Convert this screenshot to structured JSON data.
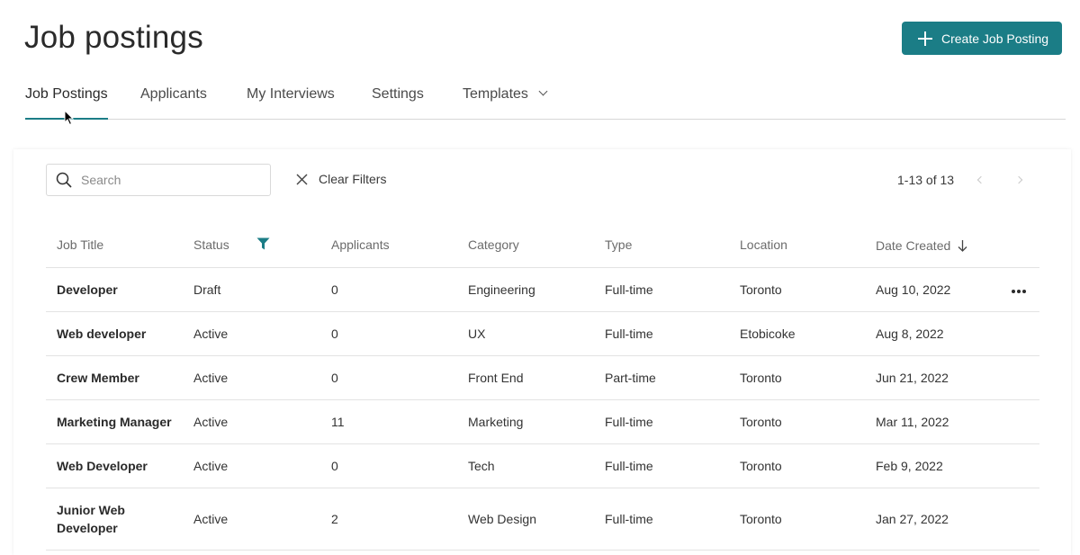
{
  "page_title": "Job postings",
  "create_button": {
    "label": "Create Job Posting"
  },
  "tabs": [
    {
      "label": "Job Postings",
      "active": true
    },
    {
      "label": "Applicants"
    },
    {
      "label": "My Interviews"
    },
    {
      "label": "Settings"
    },
    {
      "label": "Templates",
      "has_dropdown": true
    }
  ],
  "search": {
    "placeholder": "Search",
    "value": ""
  },
  "clear_filters": {
    "label": "Clear Filters"
  },
  "pagination": {
    "label": "1-13 of 13"
  },
  "columns": [
    "Job Title",
    "Status",
    "Applicants",
    "Category",
    "Type",
    "Location",
    "Date Created"
  ],
  "rows": [
    {
      "title": "Developer",
      "status": "Draft",
      "applicants": "0",
      "category": "Engineering",
      "type": "Full-time",
      "location": "Toronto",
      "date": "Aug 10, 2022"
    },
    {
      "title": "Web developer",
      "status": "Active",
      "applicants": "0",
      "category": "UX",
      "type": "Full-time",
      "location": "Etobicoke",
      "date": "Aug 8, 2022"
    },
    {
      "title": "Crew Member",
      "status": "Active",
      "applicants": "0",
      "category": "Front End",
      "type": "Part-time",
      "location": "Toronto",
      "date": "Jun 21, 2022"
    },
    {
      "title": "Marketing Manager",
      "status": "Active",
      "applicants": "11",
      "category": "Marketing",
      "type": "Full-time",
      "location": "Toronto",
      "date": "Mar 11, 2022"
    },
    {
      "title": "Web Developer",
      "status": "Active",
      "applicants": "0",
      "category": "Tech",
      "type": "Full-time",
      "location": "Toronto",
      "date": "Feb 9, 2022"
    },
    {
      "title": "Junior Web Developer",
      "status": "Active",
      "applicants": "2",
      "category": "Web Design",
      "type": "Full-time",
      "location": "Toronto",
      "date": "Jan 27, 2022"
    }
  ],
  "colors": {
    "accent": "#1b7d86",
    "text": "#2a2a2a",
    "muted": "#6b6b6b",
    "border": "#e3e3e3"
  },
  "icons": {
    "add": "plus-icon",
    "search": "search-icon",
    "clear": "close-icon",
    "filter": "filter-icon",
    "sort": "arrow-down-icon",
    "more": "more-horizontal-icon"
  }
}
